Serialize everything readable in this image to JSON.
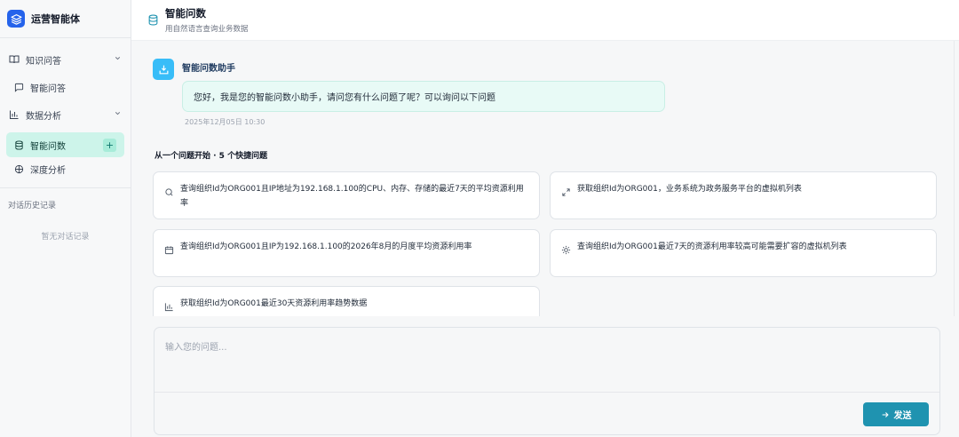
{
  "app": {
    "title": "运营智能体"
  },
  "sidebar": {
    "groups": [
      {
        "label": "知识问答",
        "items": [
          {
            "label": "智能问答"
          }
        ]
      },
      {
        "label": "数据分析",
        "items": [
          {
            "label": "智能问数",
            "active": true
          },
          {
            "label": "深度分析"
          }
        ]
      }
    ],
    "new_label": "+",
    "history_title": "对话历史记录",
    "history_empty": "暂无对话记录"
  },
  "header": {
    "title": "智能问数",
    "subtitle": "用自然语言查询业务数据"
  },
  "chat": {
    "assistant_name": "智能问数助手",
    "message": "您好，我是您的智能问数小助手，请问您有什么问题了呢？可以询问以下问题",
    "timestamp": "2025年12月05日 10:30",
    "quick_title": "从一个问题开始 · 5 个快捷问题",
    "quick_questions": [
      {
        "icon": "search-icon",
        "text": "查询组织Id为ORG001且IP地址为192.168.1.100的CPU、内存、存储的最近7天的平均资源利用率"
      },
      {
        "icon": "expand-arrows-icon",
        "text": "获取组织Id为ORG001，业务系统为政务服务平台的虚拟机列表"
      },
      {
        "icon": "calendar-icon",
        "text": "查询组织Id为ORG001且IP为192.168.1.100的2026年8月的月度平均资源利用率"
      },
      {
        "icon": "sun-icon",
        "text": "查询组织Id为ORG001最近7天的资源利用率较高可能需要扩容的虚拟机列表"
      },
      {
        "icon": "bar-chart-icon",
        "text": "获取组织Id为ORG001最近30天资源利用率趋势数据"
      }
    ]
  },
  "composer": {
    "placeholder": "输入您的问题...",
    "send_label": "发送"
  },
  "colors": {
    "brand": "#2563eb",
    "accent": "#1f93b0",
    "active_bg": "#cdf4ea",
    "bubble_bg": "#e8faf6"
  }
}
